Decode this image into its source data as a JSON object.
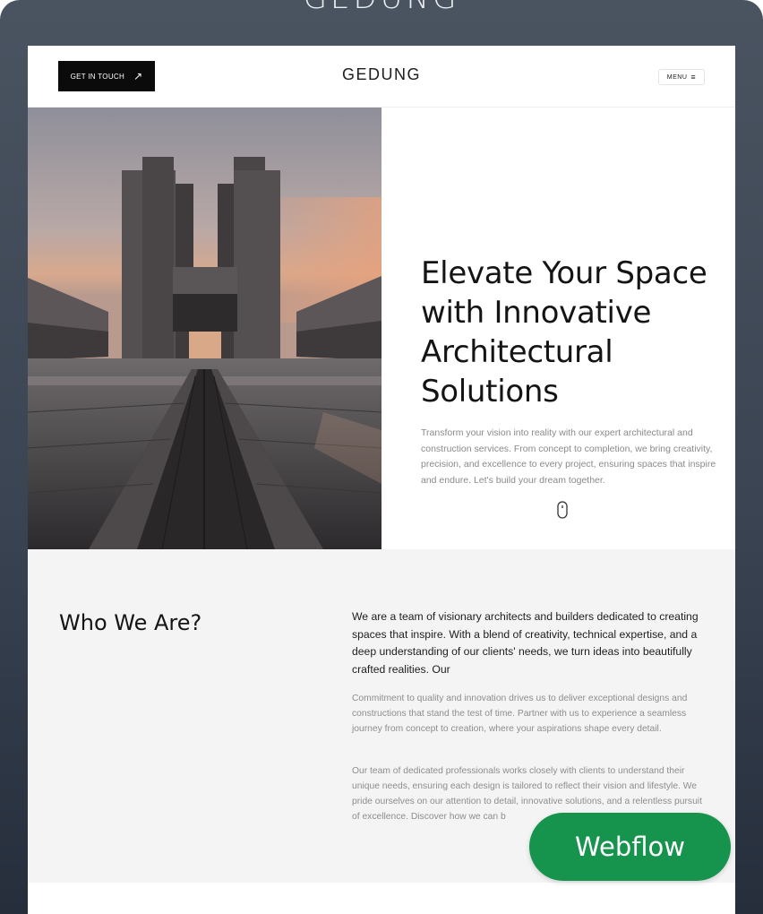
{
  "frame": {
    "title": "GEDUNG"
  },
  "header": {
    "cta_label": "GET IN TOUCH",
    "cta_icon": "arrow-up-right-icon",
    "brand": "GEDUNG",
    "menu_label": "MENU",
    "menu_icon": "hamburger-icon"
  },
  "hero": {
    "image": "brutalist-building-at-sunset",
    "title": "Elevate Your Space with Innovative Architectural Solutions",
    "description": "Transform your vision into reality with our expert architectural and construction services. From concept to completion, we bring creativity, precision, and excellence to every project, ensuring spaces that inspire and endure. Let's build your dream together.",
    "scroll_icon": "mouse-scroll-icon"
  },
  "about": {
    "title": "Who We Are?",
    "lead": "We are a team of visionary architects and builders dedicated to creating spaces that inspire. With a blend of creativity, technical expertise, and a deep understanding of our clients' needs, we turn ideas into beautifully crafted realities. Our",
    "paragraph_2": "Commitment to quality and innovation drives us to deliver exceptional designs and constructions that stand the test of time. Partner with us to experience a seamless journey from concept to creation, where your aspirations shape every detail.",
    "paragraph_3": "Our team of dedicated professionals works closely with clients to understand their unique needs, ensuring each design is tailored to reflect their vision and lifestyle. We pride ourselves on our attention to detail, innovative solutions, and a relentless pursuit of excellence. Discover how we can b"
  },
  "badge": {
    "label": "Webflow"
  },
  "colors": {
    "badge": "#16934d",
    "cta_bg": "#0b0b0b",
    "section_bg": "#f4f4f4"
  }
}
